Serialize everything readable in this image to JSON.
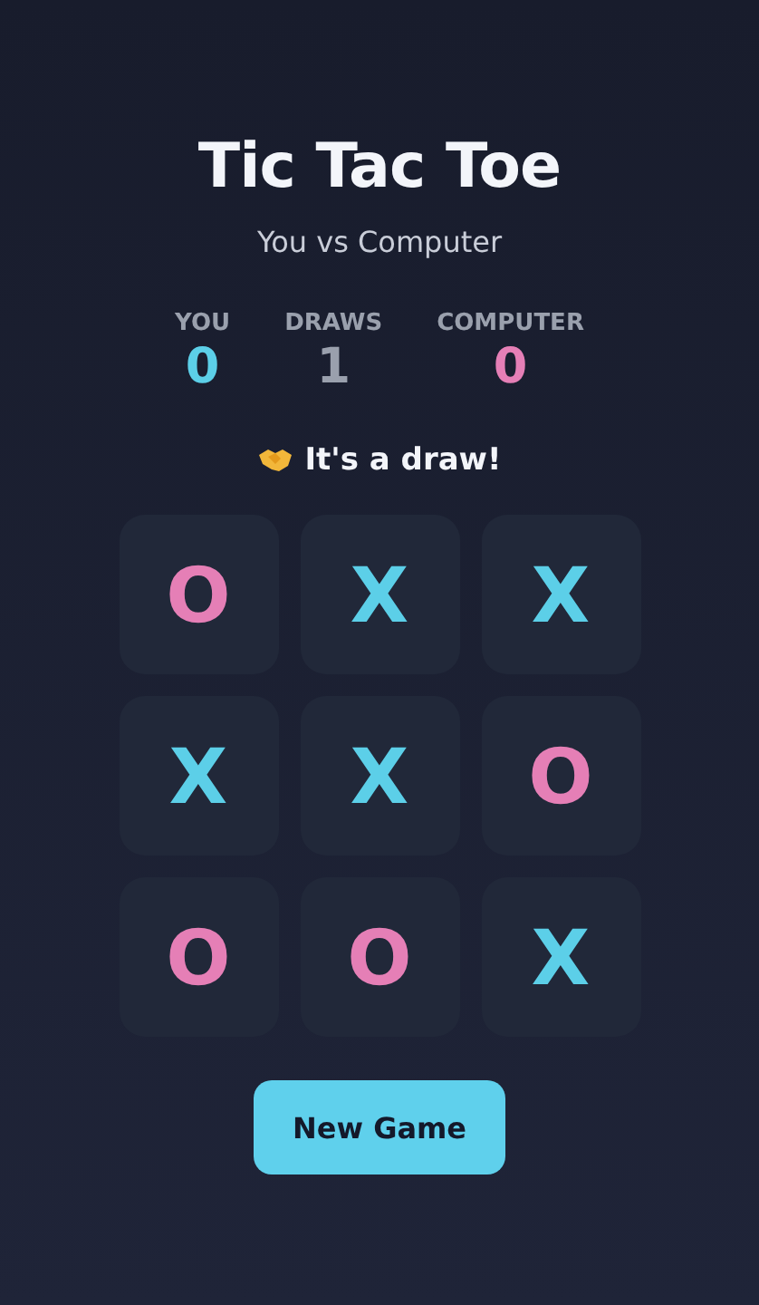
{
  "title": "Tic Tac Toe",
  "subtitle": "You vs Computer",
  "scores": [
    {
      "label": "YOU",
      "value": "0",
      "color": "#5ccfe8"
    },
    {
      "label": "DRAWS",
      "value": "1",
      "color": "#9aa0ad"
    },
    {
      "label": "COMPUTER",
      "value": "0",
      "color": "#e57fb6"
    }
  ],
  "status": "It's a draw!",
  "board": [
    {
      "mark": "O",
      "color": "#e57fb6"
    },
    {
      "mark": "X",
      "color": "#5ccfe8"
    },
    {
      "mark": "X",
      "color": "#5ccfe8"
    },
    {
      "mark": "X",
      "color": "#5ccfe8"
    },
    {
      "mark": "X",
      "color": "#5ccfe8"
    },
    {
      "mark": "O",
      "color": "#e57fb6"
    },
    {
      "mark": "O",
      "color": "#e57fb6"
    },
    {
      "mark": "O",
      "color": "#e57fb6"
    },
    {
      "mark": "X",
      "color": "#5ccfe8"
    }
  ],
  "button": "New Game"
}
